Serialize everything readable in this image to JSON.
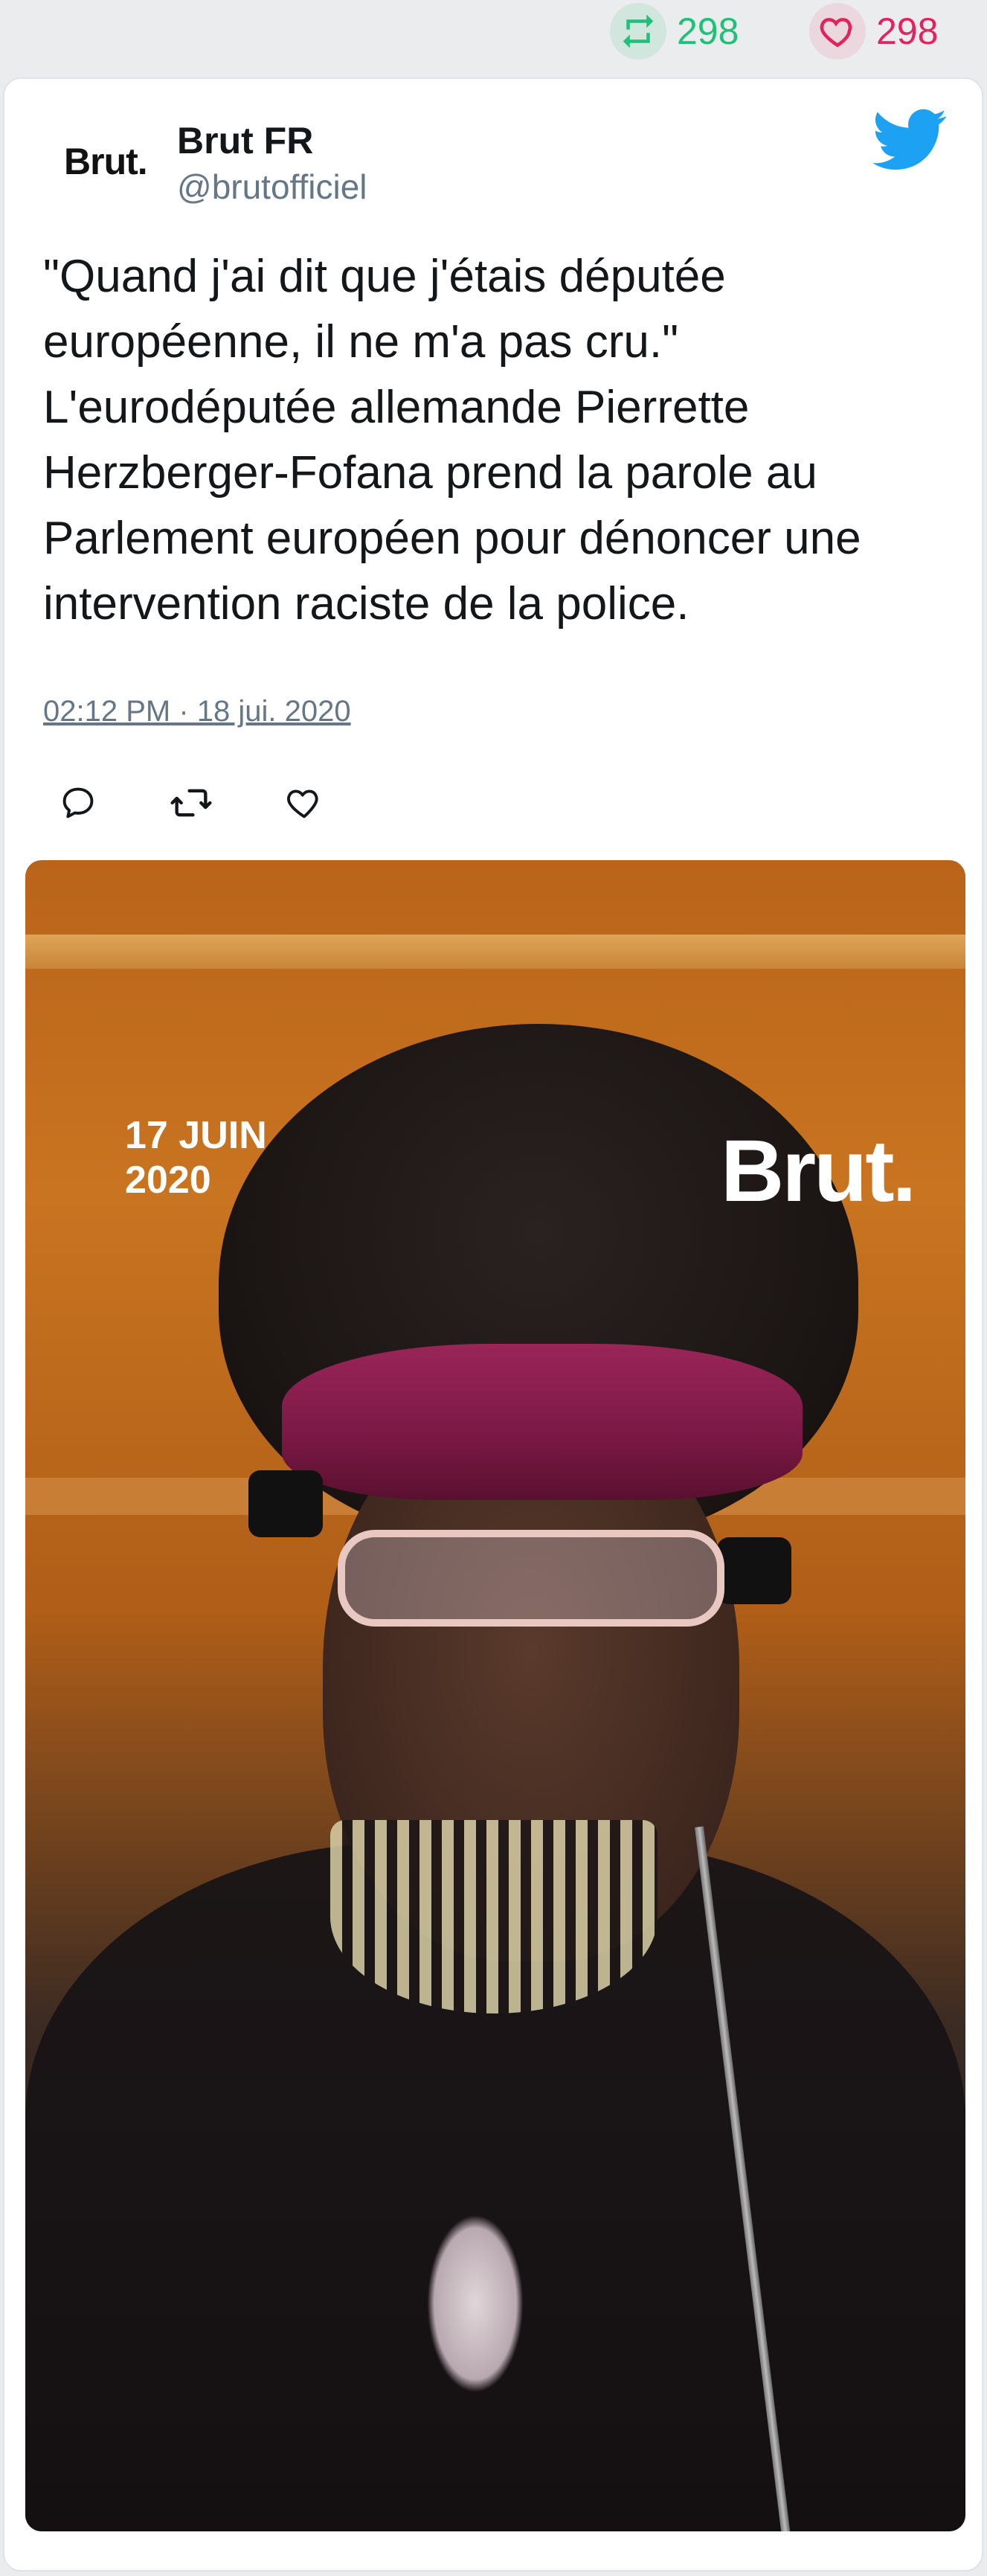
{
  "top_stats": {
    "retweet_count": "298",
    "like_count": "298"
  },
  "tweet": {
    "avatar_text": "Brut.",
    "author_name": "Brut FR",
    "author_handle": "@brutofficiel",
    "text": "\"Quand j'ai dit que j'étais députée européenne, il ne m'a pas cru.\" L'eurodéputée allemande Pierrette Herzberger-Fofana prend la parole au Parlement européen pour dénoncer une intervention raciste de la police.",
    "timestamp": "02:12 PM · 18 jui. 2020"
  },
  "media": {
    "overlay_date": "17 JUIN\n2020",
    "overlay_brand": "Brut."
  },
  "colors": {
    "retweet_green": "#20c07a",
    "like_red": "#e0245e",
    "twitter_blue": "#1da1f2",
    "muted_text": "#657786"
  },
  "icons": {
    "top_retweet": "retweet-icon",
    "top_like": "heart-icon",
    "brand": "twitter-bird-icon",
    "reply": "reply-icon",
    "retweet": "retweet-icon",
    "like": "heart-icon"
  }
}
